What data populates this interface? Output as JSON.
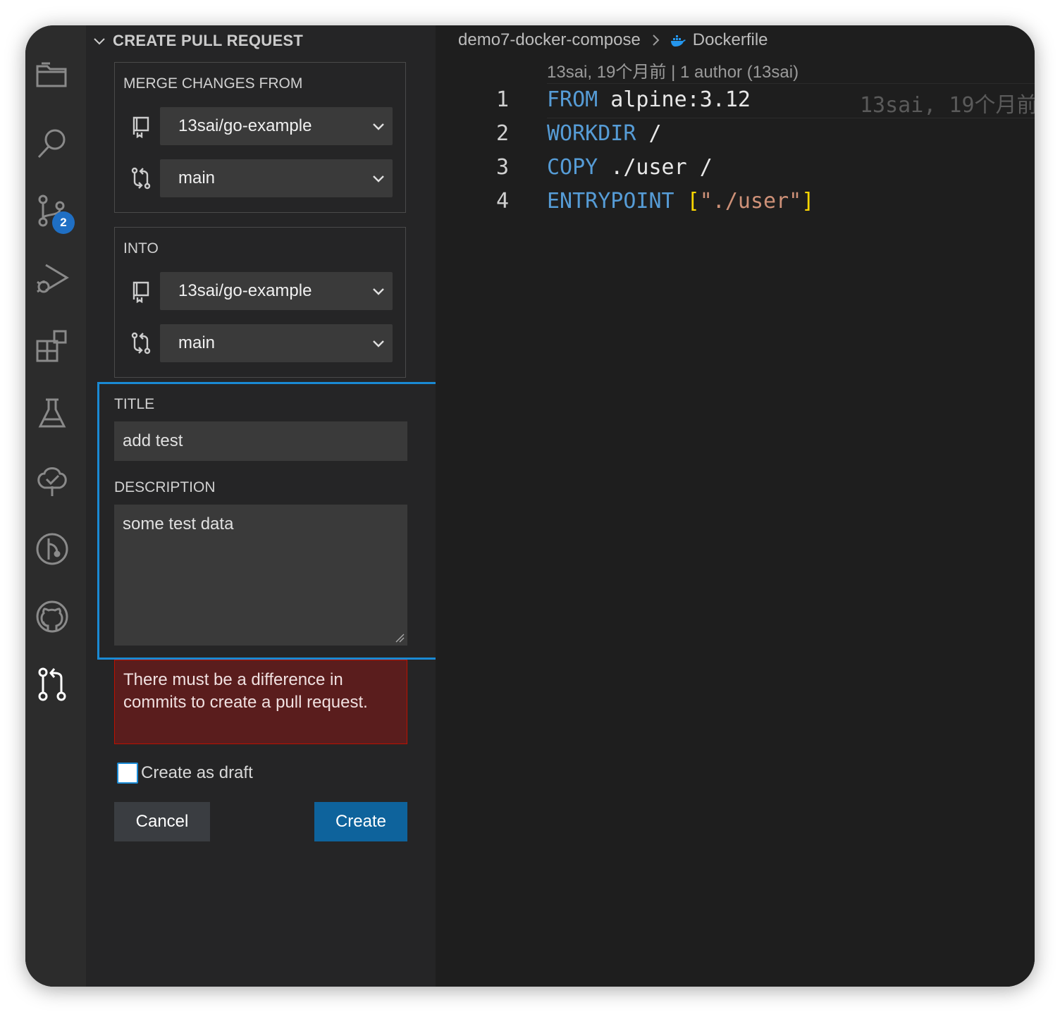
{
  "sidebar": {
    "section_title": "CREATE PULL REQUEST",
    "merge_from": {
      "label": "MERGE CHANGES FROM",
      "repo": "13sai/go-example",
      "branch": "main"
    },
    "into": {
      "label": "INTO",
      "repo": "13sai/go-example",
      "branch": "main"
    },
    "title_label": "TITLE",
    "title_value": "add test",
    "description_label": "DESCRIPTION",
    "description_value": "some test data",
    "error_message": "There must be a difference in commits to create a pull request.",
    "draft_label": "Create as draft",
    "cancel_label": "Cancel",
    "create_label": "Create"
  },
  "activity_bar": {
    "items": [
      "explorer-icon",
      "search-icon",
      "source-control-icon",
      "run-debug-icon",
      "extensions-icon",
      "testing-icon",
      "tree-check-icon",
      "git-graph-icon",
      "github-icon",
      "pull-request-icon"
    ],
    "source_control_badge": "2"
  },
  "editor": {
    "breadcrumb": {
      "folder": "demo7-docker-compose",
      "file": "Dockerfile"
    },
    "codelens": "13sai, 19个月前 | 1 author (13sai)",
    "inline_blame": "13sai, 19个月前",
    "lines": [
      {
        "num": "1",
        "kw": "FROM",
        "rest": " alpine:3.12"
      },
      {
        "num": "2",
        "kw": "WORKDIR",
        "rest": " /"
      },
      {
        "num": "3",
        "kw": "COPY",
        "rest": " ./user /"
      },
      {
        "num": "4",
        "kw": "ENTRYPOINT",
        "open": " [",
        "str": "\"./user\"",
        "close": "]"
      }
    ]
  },
  "colors": {
    "accent_focus": "#1a8ad4",
    "button_primary": "#0e639c",
    "error_bg": "#5a1d1d",
    "keyword": "#569cd6",
    "string": "#ce9178",
    "bracket": "#ffd700"
  }
}
